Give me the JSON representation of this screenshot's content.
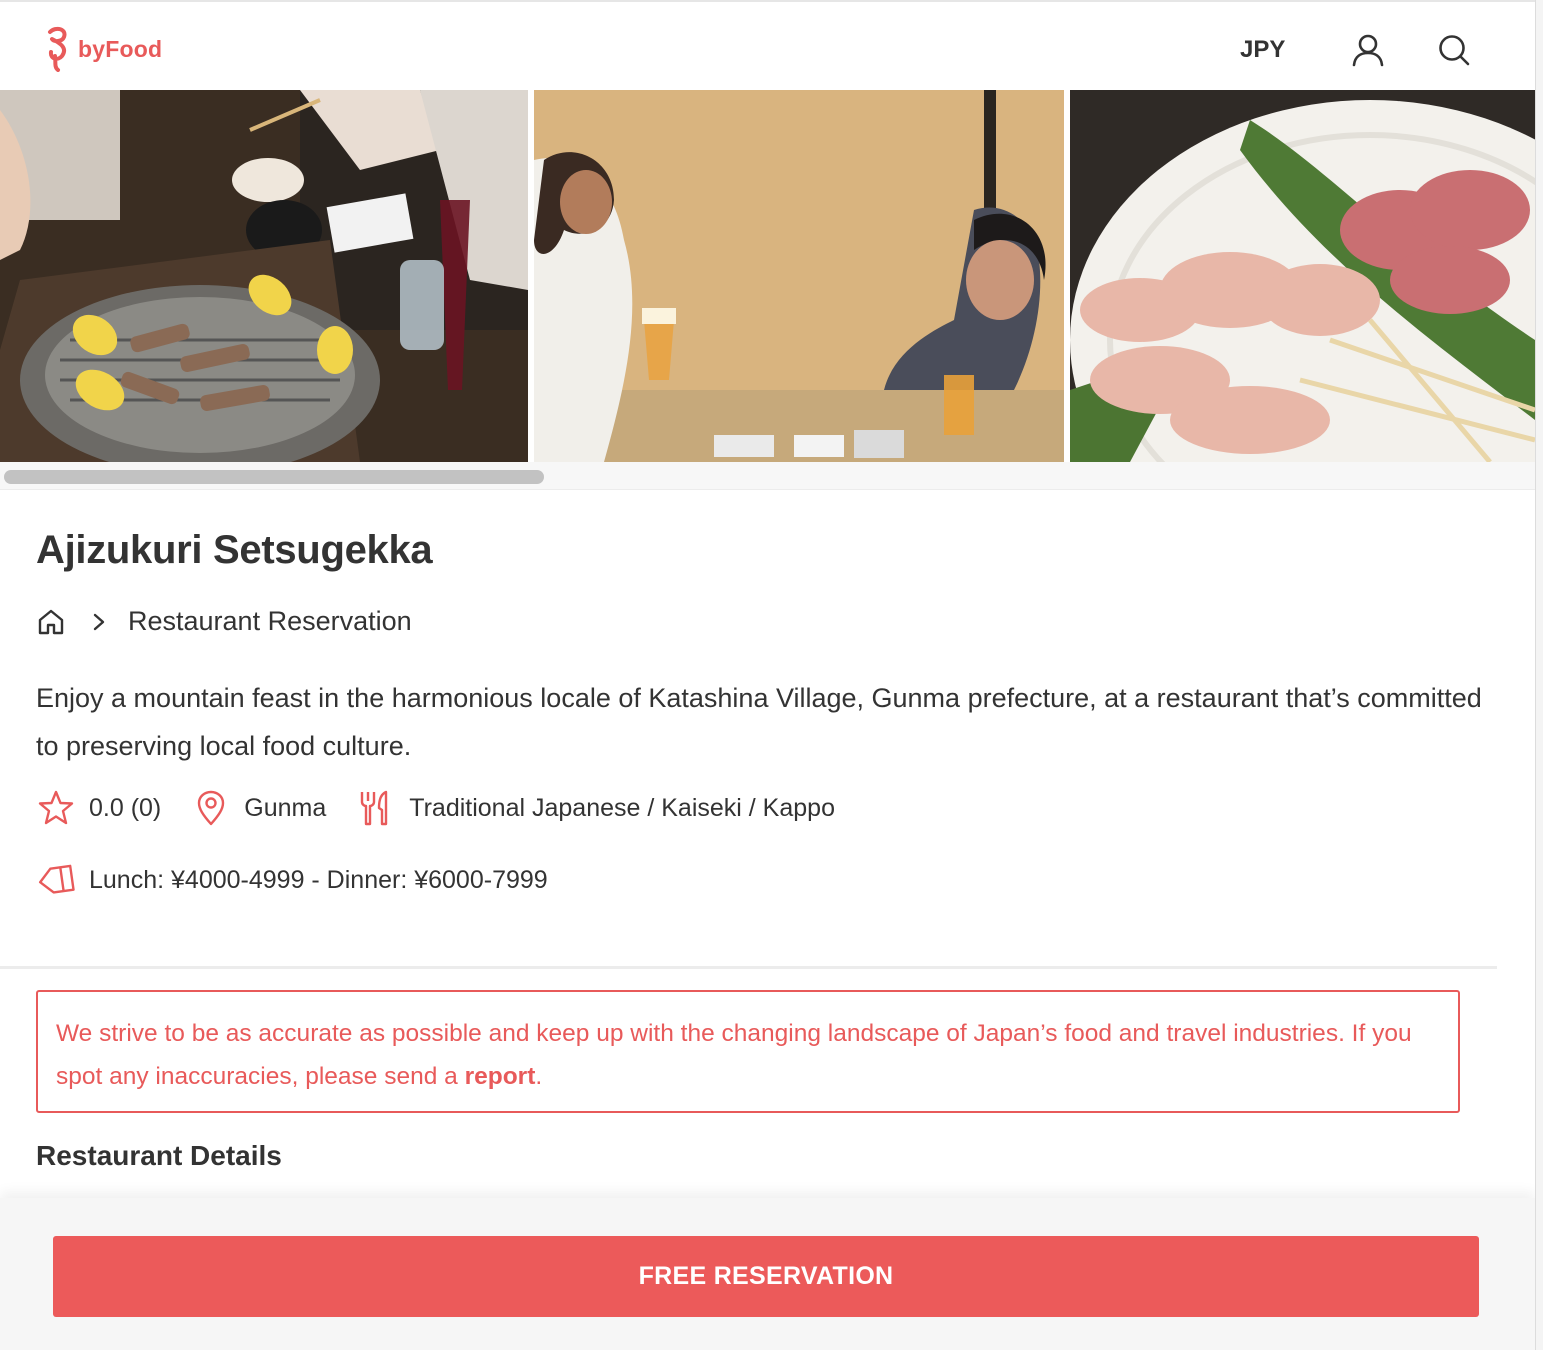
{
  "brand": {
    "name": "byFood",
    "accent_color": "#e85a5a",
    "logo_icon": "byfood-logo-icon"
  },
  "header": {
    "currency": "JPY",
    "account_icon": "user-icon",
    "search_icon": "search-icon"
  },
  "gallery": {
    "photos": [
      {
        "icon": "photo-grill-skewers-icon"
      },
      {
        "icon": "photo-diners-toasting-icon"
      },
      {
        "icon": "photo-raw-meat-platter-icon"
      }
    ]
  },
  "restaurant": {
    "name": "Ajizukuri Setsugekka",
    "breadcrumb": {
      "home_icon": "home-icon",
      "separator_icon": "chevron-right-icon",
      "current": "Restaurant Reservation"
    },
    "description": "Enjoy a mountain feast in the harmonious locale of Katashina Village, Gunma prefecture, at a restaurant that’s committed to preserving local food culture.",
    "rating": "0.0 (0)",
    "location": "Gunma",
    "cuisine": "Traditional Japanese / Kaiseki / Kappo",
    "price": "Lunch: ¥4000-4999 - Dinner: ¥6000-7999"
  },
  "notice": {
    "text_before": "We strive to be as accurate as possible and keep up with the changing landscape of Japan’s food and travel industries. If you spot any inaccuracies, please send a ",
    "link": "report",
    "text_after": "."
  },
  "details": {
    "heading": "Restaurant Details"
  },
  "cta": {
    "label": "FREE RESERVATION",
    "color": "#ec5a5a"
  }
}
